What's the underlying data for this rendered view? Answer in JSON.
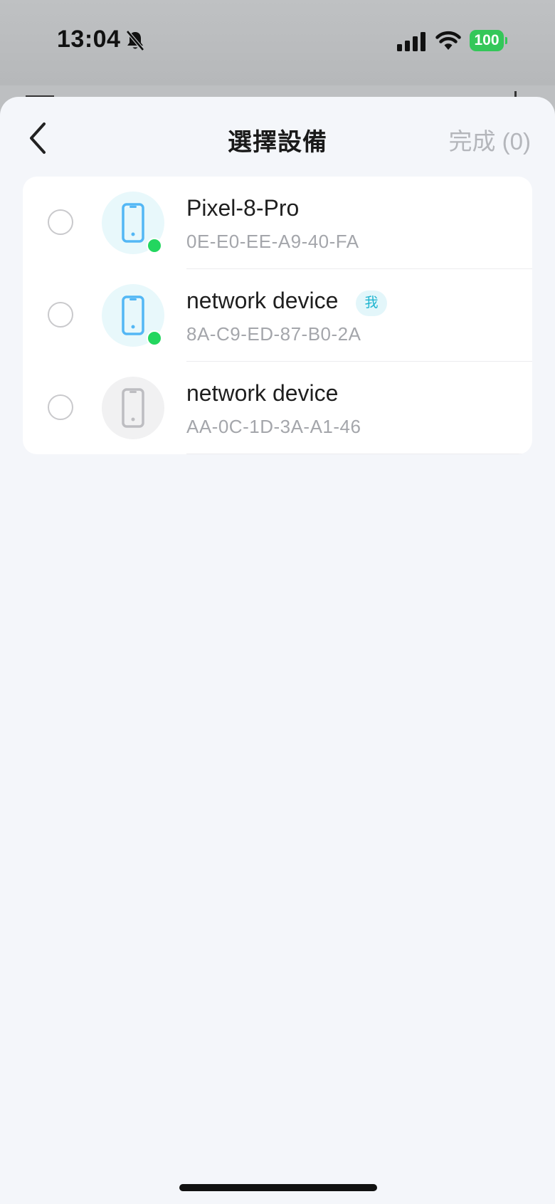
{
  "status_bar": {
    "time": "13:04",
    "battery": "100"
  },
  "header": {
    "title": "選擇設備",
    "done_label": "完成 (0)"
  },
  "devices": [
    {
      "name": "Pixel-8-Pro",
      "mac": "0E-E0-EE-A9-40-FA",
      "online": true,
      "badge": ""
    },
    {
      "name": "network device",
      "mac": "8A-C9-ED-87-B0-2A",
      "online": true,
      "badge": "我"
    },
    {
      "name": "network device",
      "mac": "AA-0C-1D-3A-A1-46",
      "online": false,
      "badge": ""
    }
  ],
  "colors": {
    "accent": "#1eb4cf",
    "online_dot": "#23d65f",
    "battery": "#34c759"
  }
}
